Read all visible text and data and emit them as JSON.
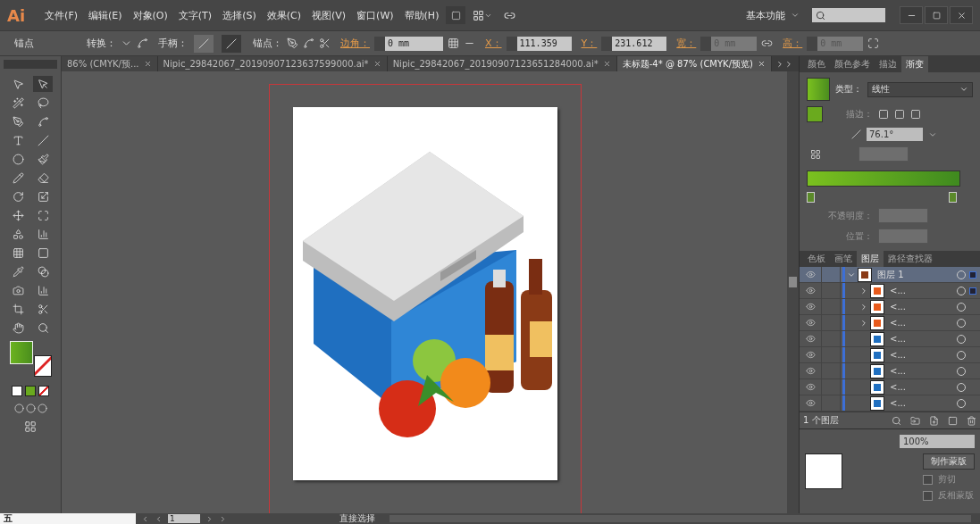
{
  "app": {
    "logo": "Ai",
    "menu": [
      "文件(F)",
      "编辑(E)",
      "对象(O)",
      "文字(T)",
      "选择(S)",
      "效果(C)",
      "视图(V)",
      "窗口(W)",
      "帮助(H)"
    ],
    "workspace": "基本功能"
  },
  "control_bar": {
    "selection": "锚点",
    "convert_label": "转换：",
    "handle_label": "手柄：",
    "anchor_label": "锚点：",
    "corner_label": "边角：",
    "corner_value": "0 mm",
    "x_label": "X：",
    "x_value": "111.359",
    "y_label": "Y：",
    "y_value": "231.612",
    "w_label": "宽：",
    "w_value": "0 mm",
    "h_label": "高：",
    "h_value": "0 mm"
  },
  "documents": [
    {
      "title": "86% (CMYK/预...",
      "selected": false
    },
    {
      "title": "Nipic_29842067_20190907123637599000.ai*",
      "selected": false
    },
    {
      "title": "Nipic_29842067_20190907123651284000.ai*",
      "selected": false
    },
    {
      "title": "未标题-4* @ 87% (CMYK/预览)",
      "selected": true
    }
  ],
  "gradient_panel": {
    "tabs": [
      {
        "label": "颜色",
        "selected": false
      },
      {
        "label": "颜色参考",
        "selected": false
      },
      {
        "label": "描边",
        "selected": false
      },
      {
        "label": "渐变",
        "selected": true
      }
    ],
    "type_label": "类型：",
    "type_value": "线性",
    "stroke_label": "描边：",
    "angle": "76.1°",
    "opacity_label": "不透明度：",
    "position_label": "位置："
  },
  "layers_panel": {
    "tabs": [
      {
        "label": "色板",
        "selected": false
      },
      {
        "label": "画笔",
        "selected": false
      },
      {
        "label": "图层",
        "selected": true
      },
      {
        "label": "路径查找器",
        "selected": false
      }
    ],
    "layers": [
      {
        "name": "图层 1",
        "kind": "layer",
        "expanded": true,
        "selected": true,
        "targeted": true,
        "children": [
          {
            "name": "<...",
            "kind": "group",
            "expanded": false,
            "selected": false,
            "targeted": true
          },
          {
            "name": "<...",
            "kind": "group",
            "expanded": false,
            "selected": false,
            "targeted": false
          },
          {
            "name": "<...",
            "kind": "group",
            "expanded": false,
            "selected": false,
            "targeted": false
          },
          {
            "name": "<...",
            "kind": "path",
            "selected": false,
            "targeted": false
          },
          {
            "name": "<...",
            "kind": "path",
            "selected": false,
            "targeted": false
          },
          {
            "name": "<...",
            "kind": "path",
            "selected": false,
            "targeted": false
          },
          {
            "name": "<...",
            "kind": "path",
            "selected": false,
            "targeted": false
          },
          {
            "name": "<...",
            "kind": "path",
            "selected": false,
            "targeted": false
          }
        ]
      }
    ],
    "footer": "1 个图层"
  },
  "transparency_panel": {
    "opacity": "100%",
    "make_mask": "制作蒙版",
    "options": [
      {
        "label": "剪切",
        "checked": false
      },
      {
        "label": "反相蒙版",
        "checked": false
      }
    ]
  },
  "status_bar": {
    "artboard": "1",
    "tool": "直接选择"
  },
  "ime_bar": {
    "mode": "五"
  }
}
